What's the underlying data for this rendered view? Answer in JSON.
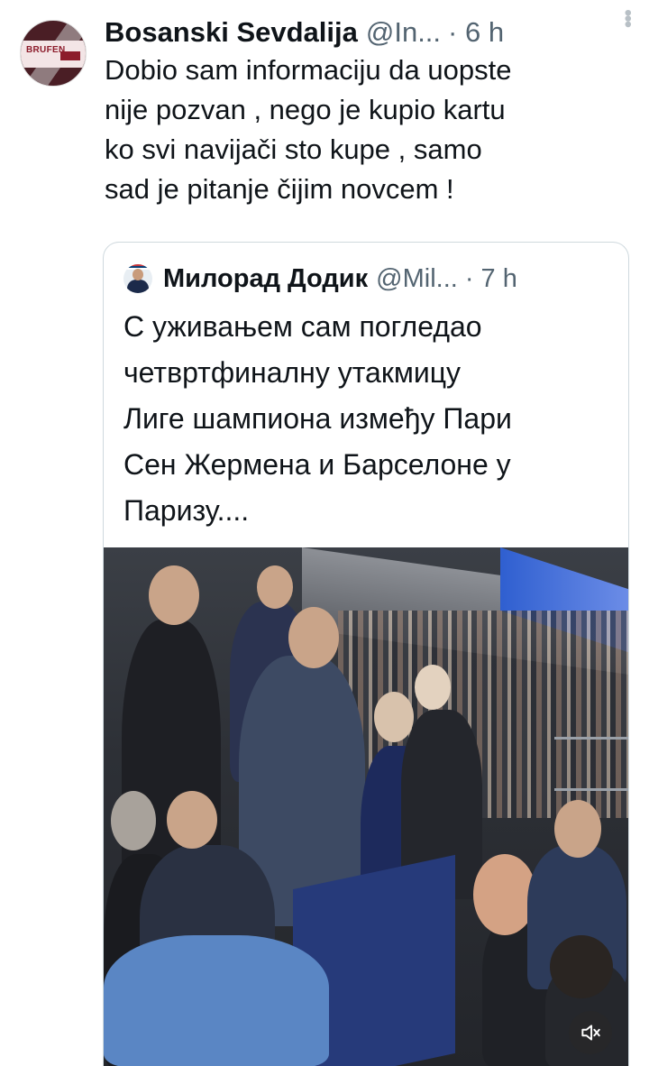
{
  "tweet": {
    "author_name": "Bosanski Sevdalija",
    "author_handle": "@In...",
    "separator": "·",
    "time": "6 h",
    "avatar_text": "BRUFEN",
    "text_lines": [
      "Dobio sam informaciju da uopste",
      "nije pozvan , nego je kupio kartu",
      "ko svi navijači sto kupe , samo",
      "sad je pitanje čijim novcem !"
    ]
  },
  "quoted_tweet": {
    "author_name": "Милорад Додик",
    "author_handle": "@Mil...",
    "separator": "·",
    "time": "7 h",
    "text_lines": [
      "С уживањем сам погледао",
      "четвртфиналну утакмицу",
      "Лиге шампиона између Пари",
      "Сен Жермена и Барселоне у",
      "Паризу...."
    ],
    "media": {
      "type": "video",
      "mute_icon": "speaker-muted-icon"
    }
  },
  "icons": {
    "more": "more-options-icon",
    "mute": "speaker-muted-icon"
  },
  "colors": {
    "text_primary": "#0f1419",
    "text_secondary": "#536471",
    "border": "#cfd9de"
  }
}
